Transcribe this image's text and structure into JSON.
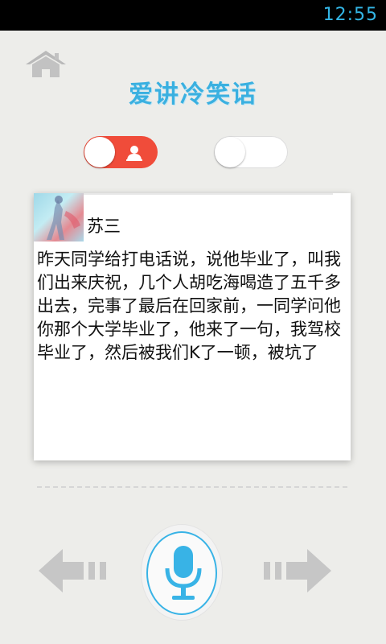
{
  "status_bar": {
    "time": "12:55"
  },
  "app": {
    "title": "爱讲冷笑话"
  },
  "toggles": [
    {
      "name": "person-mode",
      "state": "on",
      "color": "#f04c3a"
    },
    {
      "name": "second-mode",
      "state": "off"
    }
  ],
  "joke": {
    "author": "苏三",
    "text": "昨天同学给打电话说，说他毕业了，叫我们出来庆祝，几个人胡吃海喝造了五千多出去，完事了最后在回家前，一同学问他你那个大学毕业了，他来了一句，我驾校毕业了，然后被我们K了一顿，被坑了"
  },
  "icons": {
    "home": "home-icon",
    "person": "person-icon",
    "mic": "microphone-icon",
    "prev": "arrow-left-icon",
    "next": "arrow-right-icon"
  },
  "colors": {
    "accent": "#38b3e6",
    "toggle_on": "#f04c3a",
    "status_time": "#33b5e5"
  }
}
